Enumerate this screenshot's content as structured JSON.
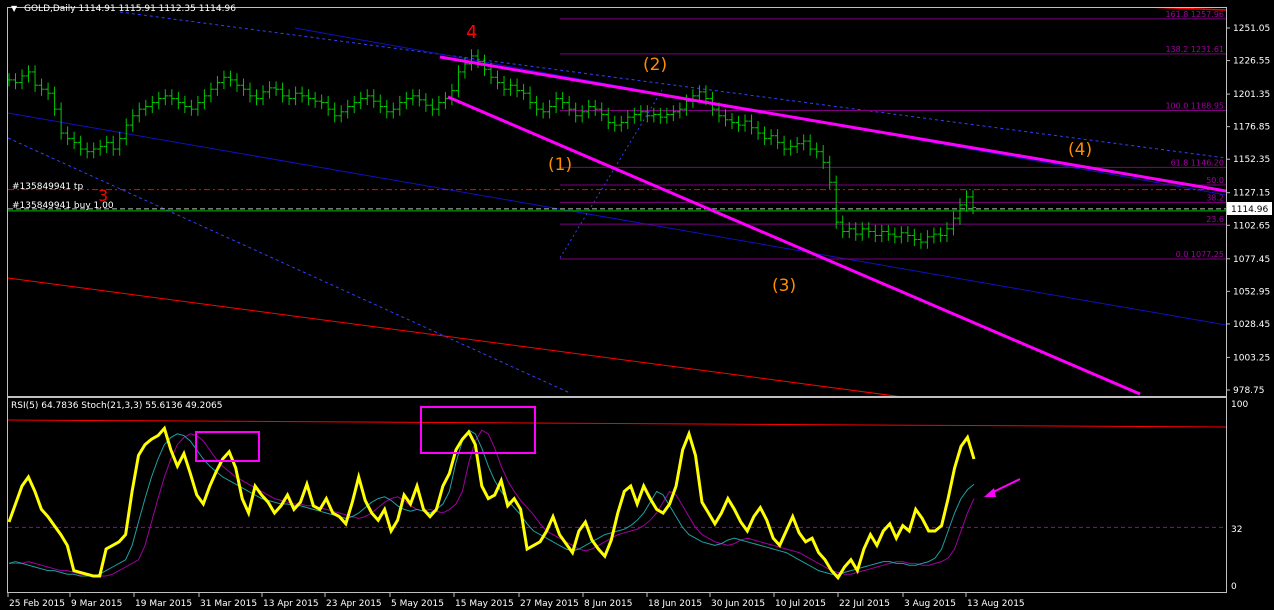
{
  "window": {
    "header_text": "GOLD,Daily  1114.91 1115.91 1112.35 1114.96",
    "menu_glyph": "▼"
  },
  "colors": {
    "background": "#000000",
    "frame": "#c0c0c0",
    "price_bar": "#00c800",
    "axis_text": "#ffffff",
    "blue_line": "#1010c0",
    "blue_dashed": "#3040ff",
    "magenta": "#ff00ff",
    "red": "#ff0000",
    "fib": "#800080",
    "fib_text": "#a000a0",
    "order_line": "#c0c0c0",
    "rsi": "#ffff00",
    "stoch_main": "#20a0a0",
    "stoch_signal": "#a000a0",
    "wave_orange": "#ff8c00",
    "wave_red": "#ff0000"
  },
  "price_panel": {
    "axis_labels": [
      "1251.05",
      "1226.55",
      "1201.35",
      "1176.85",
      "1152.35",
      "1127.15",
      "1102.65",
      "1077.45",
      "1052.95",
      "1028.45",
      "1003.25",
      "978.75"
    ],
    "current_price": "1114.96",
    "orders": [
      {
        "label": "#135849941 tp",
        "price": 1129.5
      },
      {
        "label": "#135849941 buy 1.00",
        "price": 1114.96
      }
    ],
    "wave_labels": {
      "w4_big": "4",
      "w3_big": "3",
      "w1": "(1)",
      "w2": "(2)",
      "w3": "(3)",
      "w4": "(4)"
    },
    "fibonacci": [
      {
        "label": "161.8  1257.96",
        "price": 1257.96
      },
      {
        "label": "138.2  1231.61",
        "price": 1231.61
      },
      {
        "label": "100.0  1188.95",
        "price": 1188.95
      },
      {
        "label": "61.8  1146.20",
        "price": 1146.2
      },
      {
        "label": "50.0",
        "price": 1133.0
      },
      {
        "label": "38.2",
        "price": 1119.9
      },
      {
        "label": "23.6",
        "price": 1103.5
      },
      {
        "label": "0.0  1077.25",
        "price": 1077.25
      }
    ]
  },
  "indicator_panel": {
    "header_text": "RSI(5) 64.7836  Stoch(21,3,3) 55.6136 49.2065",
    "axis_labels": [
      "100",
      "32",
      "0"
    ]
  },
  "time_axis": {
    "labels": [
      "25 Feb 2015",
      "9 Mar 2015",
      "19 Mar 2015",
      "31 Mar 2015",
      "13 Apr 2015",
      "23 Apr 2015",
      "5 May 2015",
      "15 May 2015",
      "27 May 2015",
      "8 Jun 2015",
      "18 Jun 2015",
      "30 Jun 2015",
      "10 Jul 2015",
      "22 Jul 2015",
      "3 Aug 2015",
      "13 Aug 2015"
    ]
  },
  "chart_data": [
    {
      "type": "line",
      "title": "GOLD,Daily",
      "ylim": [
        970,
        1265
      ],
      "grid": false,
      "series": [
        {
          "name": "GOLD",
          "values": [
            1212,
            1210,
            1215,
            1218,
            1208,
            1205,
            1202,
            1190,
            1172,
            1168,
            1165,
            1160,
            1158,
            1160,
            1162,
            1165,
            1160,
            1168,
            1178,
            1185,
            1190,
            1192,
            1195,
            1198,
            1200,
            1198,
            1195,
            1192,
            1190,
            1195,
            1200,
            1205,
            1210,
            1214,
            1212,
            1208,
            1205,
            1200,
            1198,
            1203,
            1206,
            1205,
            1200,
            1198,
            1202,
            1200,
            1198,
            1196,
            1195,
            1190,
            1185,
            1188,
            1192,
            1195,
            1198,
            1200,
            1196,
            1192,
            1188,
            1190,
            1195,
            1198,
            1200,
            1197,
            1193,
            1190,
            1195,
            1198,
            1204,
            1218,
            1224,
            1230,
            1226,
            1220,
            1214,
            1210,
            1205,
            1208,
            1204,
            1202,
            1195,
            1190,
            1188,
            1192,
            1198,
            1195,
            1190,
            1185,
            1188,
            1192,
            1190,
            1186,
            1180,
            1178,
            1180,
            1184,
            1186,
            1188,
            1185,
            1186,
            1184,
            1186,
            1188,
            1190,
            1196,
            1200,
            1203,
            1198,
            1190,
            1185,
            1182,
            1180,
            1178,
            1181,
            1176,
            1172,
            1168,
            1170,
            1165,
            1160,
            1162,
            1164,
            1166,
            1160,
            1158,
            1150,
            1135,
            1105,
            1098,
            1100,
            1096,
            1100,
            1098,
            1095,
            1098,
            1096,
            1094,
            1097,
            1095,
            1092,
            1090,
            1094,
            1096,
            1095,
            1100,
            1108,
            1118,
            1124,
            1116
          ]
        }
      ]
    },
    {
      "type": "line",
      "title": "RSI(5) / Stoch(21,3,3)",
      "ylim": [
        0,
        100
      ],
      "grid": false,
      "series": [
        {
          "name": "RSI(5)",
          "values": [
            35,
            45,
            55,
            60,
            52,
            42,
            38,
            33,
            28,
            22,
            8,
            7,
            6,
            5,
            5,
            20,
            22,
            24,
            28,
            52,
            72,
            78,
            81,
            83,
            87,
            75,
            66,
            73,
            62,
            50,
            45,
            55,
            63,
            70,
            74,
            65,
            48,
            40,
            55,
            50,
            46,
            40,
            44,
            50,
            42,
            46,
            56,
            44,
            42,
            48,
            40,
            38,
            34,
            46,
            60,
            47,
            40,
            36,
            42,
            30,
            36,
            50,
            45,
            55,
            42,
            38,
            42,
            55,
            62,
            75,
            81,
            85,
            78,
            55,
            48,
            50,
            58,
            44,
            48,
            42,
            20,
            22,
            24,
            30,
            38,
            28,
            23,
            18,
            30,
            35,
            25,
            20,
            16,
            25,
            40,
            52,
            55,
            45,
            55,
            48,
            42,
            40,
            45,
            55,
            75,
            84,
            72,
            46,
            40,
            34,
            40,
            48,
            42,
            35,
            30,
            38,
            43,
            36,
            26,
            22,
            30,
            38,
            29,
            24,
            26,
            18,
            14,
            8,
            4,
            10,
            14,
            8,
            20,
            28,
            22,
            30,
            34,
            26,
            33,
            30,
            42,
            37,
            30,
            30,
            33,
            48,
            65,
            77,
            82,
            70
          ]
        },
        {
          "name": "Stoch(21,3,3)",
          "values": [
            12,
            13,
            12,
            11,
            10,
            9,
            8,
            8,
            7,
            6,
            6,
            5,
            5,
            5,
            6,
            8,
            10,
            12,
            14,
            22,
            35,
            48,
            60,
            70,
            78,
            82,
            84,
            83,
            80,
            75,
            70,
            66,
            63,
            60,
            58,
            56,
            54,
            52,
            50,
            48,
            47,
            46,
            45,
            45,
            44,
            44,
            43,
            42,
            41,
            40,
            39,
            38,
            37,
            38,
            40,
            43,
            46,
            48,
            49,
            47,
            44,
            42,
            41,
            42,
            41,
            40,
            42,
            45,
            52,
            68,
            80,
            86,
            84,
            76,
            66,
            58,
            52,
            47,
            43,
            39,
            34,
            30,
            28,
            26,
            24,
            22,
            20,
            19,
            20,
            22,
            24,
            26,
            28,
            29,
            30,
            31,
            33,
            36,
            40,
            46,
            52,
            50,
            44,
            38,
            32,
            28,
            26,
            24,
            23,
            22,
            23,
            25,
            26,
            25,
            24,
            23,
            22,
            21,
            20,
            19,
            18,
            16,
            14,
            12,
            10,
            8,
            7,
            6,
            6,
            7,
            8,
            9,
            10,
            11,
            12,
            13,
            13,
            12,
            12,
            11,
            11,
            12,
            13,
            15,
            20,
            30,
            40,
            48,
            53,
            56
          ]
        }
      ]
    }
  ]
}
